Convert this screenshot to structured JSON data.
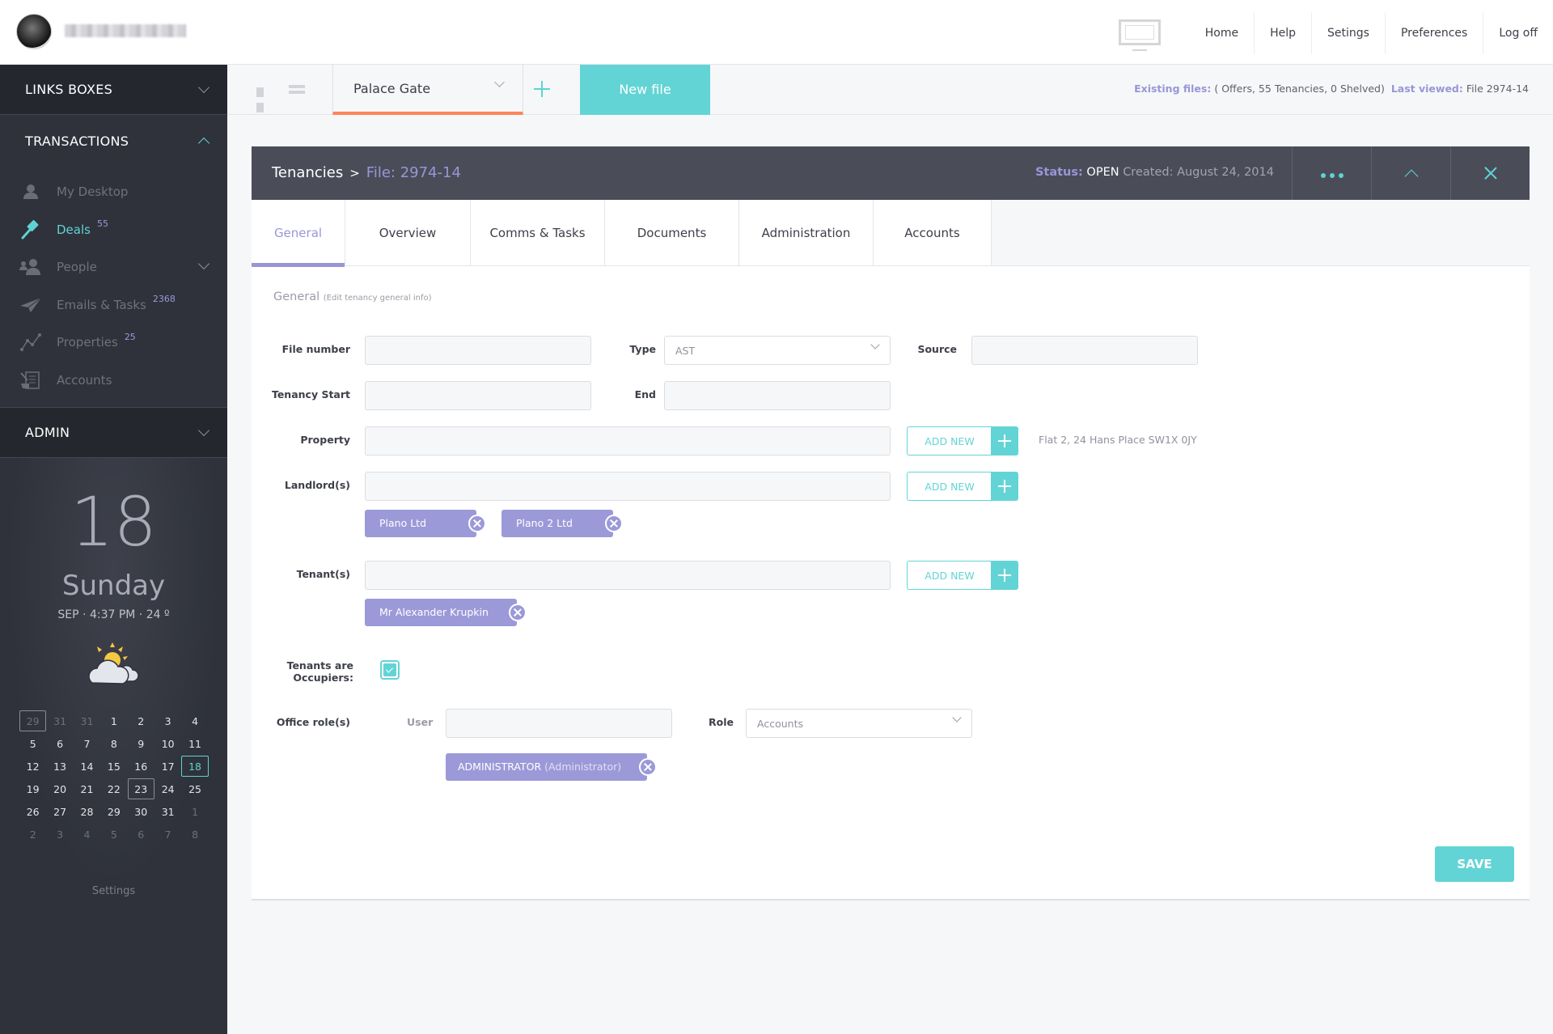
{
  "topbar": {
    "user_name": "(blurred)",
    "nav": [
      "Home",
      "Help",
      "Setings",
      "Preferences",
      "Log off"
    ]
  },
  "sidebar": {
    "links_boxes": "LINKS BOXES",
    "transactions": "TRANSACTIONS",
    "items": [
      {
        "label": "My Desktop",
        "icon": "user-icon",
        "badge": ""
      },
      {
        "label": "Deals",
        "icon": "gavel-icon",
        "badge": "55",
        "active": true
      },
      {
        "label": "People",
        "icon": "people-icon",
        "badge": ""
      },
      {
        "label": "Emails & Tasks",
        "icon": "paper-plane-icon",
        "badge": "2368"
      },
      {
        "label": "Properties",
        "icon": "line-chart-icon",
        "badge": "25"
      },
      {
        "label": "Accounts",
        "icon": "scroll-icon",
        "badge": ""
      }
    ],
    "admin": "ADMIN",
    "date": {
      "day": "18",
      "weekday": "Sunday",
      "meta": "SEP · 4:37 PM · 24 º",
      "weather": "partly-cloudy-icon"
    },
    "calendar": [
      [
        "29",
        "31",
        "31",
        "1",
        "2",
        "3",
        "4"
      ],
      [
        "5",
        "6",
        "7",
        "8",
        "9",
        "10",
        "11"
      ],
      [
        "12",
        "13",
        "14",
        "15",
        "16",
        "17",
        "18"
      ],
      [
        "19",
        "20",
        "21",
        "22",
        "23",
        "24",
        "25"
      ],
      [
        "26",
        "27",
        "28",
        "29",
        "30",
        "31",
        "1"
      ],
      [
        "2",
        "3",
        "4",
        "5",
        "6",
        "7",
        "8"
      ]
    ],
    "calendar_today": "18",
    "calendar_marked": "23",
    "settings": "Settings"
  },
  "toolbar": {
    "location": "Palace Gate",
    "new_file": "New file",
    "existing_label": "Existing files:",
    "existing_value": "( Offers, 55 Tenancies, 0 Shelved)",
    "last_viewed_label": "Last viewed:",
    "last_viewed_value": "File 2974-14"
  },
  "panel": {
    "crumb_root": "Tenancies",
    "crumb_sep": ">",
    "crumb_file": "File: 2974-14",
    "status_label": "Status:",
    "status_value": "OPEN",
    "created": "Created: August 24, 2014",
    "tabs": [
      "General",
      "Overview",
      "Comms & Tasks",
      "Documents",
      "Administration",
      "Accounts"
    ],
    "active_tab": "General"
  },
  "form": {
    "title": "General",
    "subtitle": "(Edit tenancy general info)",
    "file_number": {
      "label": "File number",
      "value": ""
    },
    "type": {
      "label": "Type",
      "value": "AST"
    },
    "source": {
      "label": "Source",
      "value": ""
    },
    "tenancy_start": {
      "label": "Tenancy Start",
      "value": ""
    },
    "end": {
      "label": "End",
      "value": ""
    },
    "property": {
      "label": "Property",
      "value": "",
      "address": "Flat 2, 24 Hans Place SW1X 0JY"
    },
    "landlords": {
      "label": "Landlord(s)",
      "value": "",
      "chips": [
        "Plano Ltd",
        "Plano 2 Ltd"
      ]
    },
    "tenants": {
      "label": "Tenant(s)",
      "value": "",
      "chips": [
        "Mr Alexander Krupkin"
      ]
    },
    "add_new": "ADD NEW",
    "occupiers": {
      "label_1": "Tenants are",
      "label_2": "Occupiers:",
      "checked": true
    },
    "office_roles": {
      "label": "Office role(s)",
      "user_label": "User",
      "user_value": "",
      "role_label": "Role",
      "role_value": "Accounts",
      "chip_main": "ADMINISTRATOR",
      "chip_sub": "(Administrator)"
    },
    "save": "SAVE"
  }
}
